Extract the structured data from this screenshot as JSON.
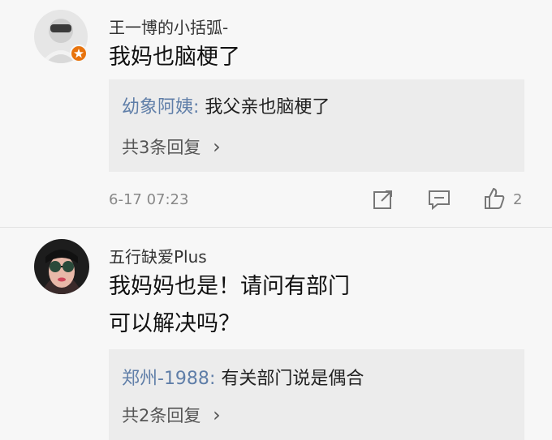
{
  "comments": [
    {
      "username": "王一博的小括弧-",
      "text": "我妈也脑梗了",
      "reply_user": "幼象阿姨",
      "reply_colon": ": ",
      "reply_text": "我父亲也脑梗了",
      "reply_count": "共3条回复",
      "chevron": "›",
      "timestamp": "6-17 07:23",
      "like_count": "2",
      "icons": [
        "share-icon",
        "comment-icon",
        "like-icon"
      ]
    },
    {
      "username": "五行缺爱Plus",
      "text": "我妈妈也是！请问有部门可以解决吗？",
      "reply_user": "郑州-1988",
      "reply_colon": ": ",
      "reply_text": "有关部门说是偶合",
      "reply_count": "共2条回复",
      "chevron": "›"
    }
  ]
}
